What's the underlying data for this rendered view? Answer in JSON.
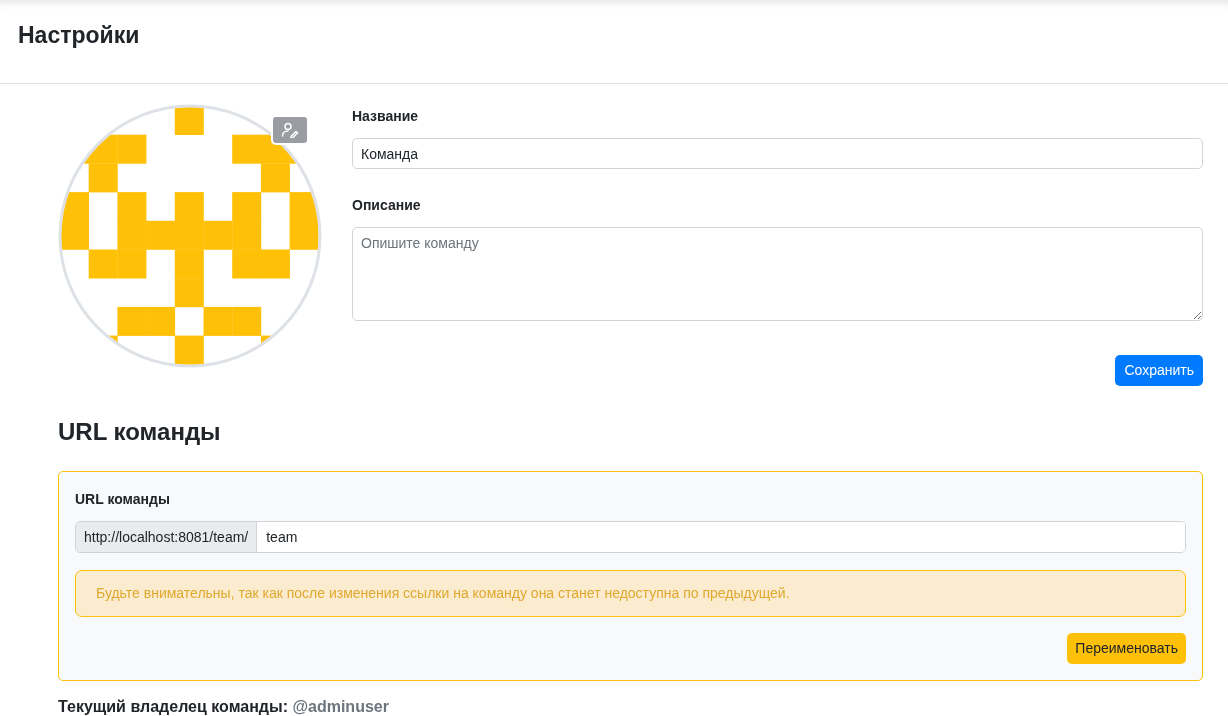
{
  "header": {
    "title": "Настройки"
  },
  "form": {
    "name": {
      "label": "Название",
      "value": "Команда"
    },
    "description": {
      "label": "Описание",
      "placeholder": "Опишите команду"
    },
    "save_button": "Сохранить"
  },
  "team_url": {
    "heading": "URL команды",
    "label": "URL команды",
    "prefix": "http://localhost:8081/team/",
    "value": "team",
    "warning": "Будьте внимательны, так как после изменения ссылки на команду она станет недоступна по предыдущей.",
    "rename_button": "Переименовать"
  },
  "owner": {
    "label": "Текущий владелец команды:",
    "username": "@adminuser"
  }
}
